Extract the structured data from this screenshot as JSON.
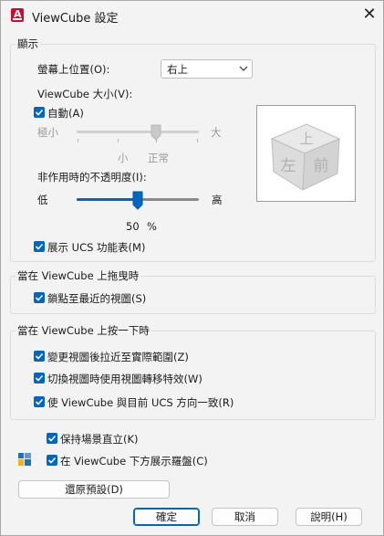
{
  "window": {
    "title": "ViewCube 設定",
    "app_icon_letter": "A"
  },
  "display": {
    "group_label": "顯示",
    "screen_position": {
      "label": "螢幕上位置(O):",
      "value": "右上"
    },
    "size": {
      "label": "ViewCube 大小(V):",
      "auto_label": "自動(A)",
      "auto_checked": true,
      "min_label": "極小",
      "max_label": "大",
      "tick_small": "小",
      "tick_normal": "正常",
      "slider_fraction": 0.67
    },
    "opacity": {
      "label": "非作用時的不透明度(I):",
      "low_label": "低",
      "high_label": "高",
      "value_text": "50",
      "unit": "%",
      "percent": 50
    },
    "show_ucs_menu": {
      "label": "展示 UCS 功能表(M)",
      "checked": true
    },
    "cube_faces": {
      "top": "上",
      "left": "左",
      "front": "前"
    }
  },
  "drag": {
    "group_label": "當在 ViewCube 上拖曳時",
    "snap": {
      "label": "鎖點至最近的視圖(S)",
      "checked": true
    }
  },
  "click": {
    "group_label": "當在 ViewCube 上按一下時",
    "zoom_extents": {
      "label": "變更視圖後拉近至實際範圍(Z)",
      "checked": true
    },
    "transition": {
      "label": "切換視圖時使用視圖轉移特效(W)",
      "checked": true
    },
    "orient_ucs": {
      "label": "使 ViewCube 與目前 UCS 方向一致(R)",
      "checked": true
    }
  },
  "keep_upright": {
    "label": "保持場景直立(K)",
    "checked": true
  },
  "show_compass": {
    "label": "在 ViewCube 下方展示羅盤(C)",
    "checked": true
  },
  "buttons": {
    "restore": "還原預設(D)",
    "ok": "確定",
    "cancel": "取消",
    "help": "說明(H)"
  }
}
